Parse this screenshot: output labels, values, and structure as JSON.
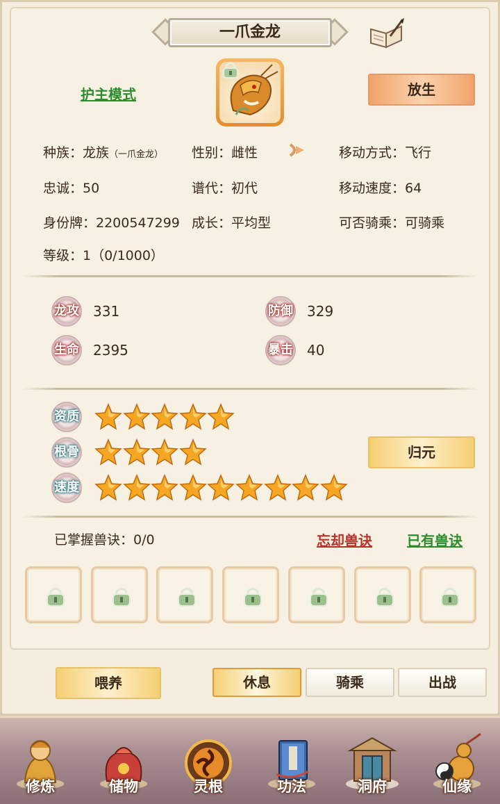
{
  "pet": {
    "name": "一爪金龙",
    "mode_link": "护主模式",
    "release_button": "放生"
  },
  "info": {
    "race_label": "种族：龙族",
    "race_sub": "（一爪金龙）",
    "gender": "性别：雌性",
    "movement": "移动方式：飞行",
    "loyalty": "忠诚：50",
    "generation": "谱代：初代",
    "move_speed": "移动速度：64",
    "id_tag": "身份牌：2200547299",
    "growth": "成长：平均型",
    "rideable": "可否骑乘：可骑乘",
    "level": "等级：1（0/1000）"
  },
  "stats": [
    {
      "label": "龙攻",
      "value": "331"
    },
    {
      "label": "防御",
      "value": "329"
    },
    {
      "label": "生命",
      "value": "2395"
    },
    {
      "label": "暴击",
      "value": "40"
    }
  ],
  "aptitudes": [
    {
      "label": "资质",
      "stars": 5
    },
    {
      "label": "根骨",
      "stars": 4
    },
    {
      "label": "速度",
      "stars": 9
    }
  ],
  "return_button": "归元",
  "skills": {
    "mastered": "已掌握兽诀：0/0",
    "forget_link": "忘却兽诀",
    "owned_link": "已有兽诀",
    "slots": 7
  },
  "actions": {
    "feed": "喂养",
    "rest": "休息",
    "ride": "骑乘",
    "battle": "出战"
  },
  "nav": [
    "修炼",
    "储物",
    "灵根",
    "功法",
    "洞府",
    "仙缘"
  ],
  "colors": {
    "star": "#f5a623",
    "stat_badge_text": "#a8322b",
    "apt_badge_text": "#2e7d88",
    "link_green": "#2e8c2e",
    "link_red": "#b8322a"
  }
}
